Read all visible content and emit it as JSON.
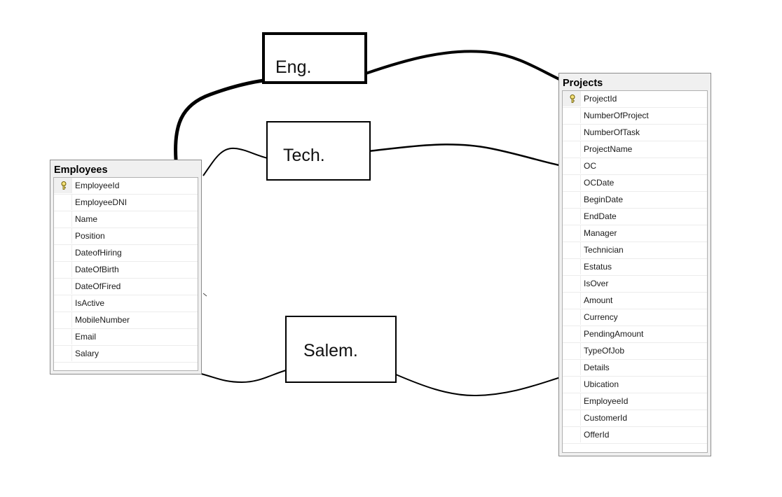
{
  "employees": {
    "title": "Employees",
    "columns": [
      {
        "name": "EmployeeId",
        "primary_key": true
      },
      {
        "name": "EmployeeDNI",
        "primary_key": false
      },
      {
        "name": "Name",
        "primary_key": false
      },
      {
        "name": "Position",
        "primary_key": false
      },
      {
        "name": "DateofHiring",
        "primary_key": false
      },
      {
        "name": "DateOfBirth",
        "primary_key": false
      },
      {
        "name": "DateOfFired",
        "primary_key": false
      },
      {
        "name": "IsActive",
        "primary_key": false
      },
      {
        "name": "MobileNumber",
        "primary_key": false
      },
      {
        "name": "Email",
        "primary_key": false
      },
      {
        "name": "Salary",
        "primary_key": false
      }
    ]
  },
  "projects": {
    "title": "Projects",
    "columns": [
      {
        "name": "ProjectId",
        "primary_key": true
      },
      {
        "name": "NumberOfProject",
        "primary_key": false
      },
      {
        "name": "NumberOfTask",
        "primary_key": false
      },
      {
        "name": "ProjectName",
        "primary_key": false
      },
      {
        "name": "OC",
        "primary_key": false
      },
      {
        "name": "OCDate",
        "primary_key": false
      },
      {
        "name": "BeginDate",
        "primary_key": false
      },
      {
        "name": "EndDate",
        "primary_key": false
      },
      {
        "name": "Manager",
        "primary_key": false
      },
      {
        "name": "Technician",
        "primary_key": false
      },
      {
        "name": "Estatus",
        "primary_key": false
      },
      {
        "name": "IsOver",
        "primary_key": false
      },
      {
        "name": "Amount",
        "primary_key": false
      },
      {
        "name": "Currency",
        "primary_key": false
      },
      {
        "name": "PendingAmount",
        "primary_key": false
      },
      {
        "name": "TypeOfJob",
        "primary_key": false
      },
      {
        "name": "Details",
        "primary_key": false
      },
      {
        "name": "Ubication",
        "primary_key": false
      },
      {
        "name": "EmployeeId",
        "primary_key": false
      },
      {
        "name": "CustomerId",
        "primary_key": false
      },
      {
        "name": "OfferId",
        "primary_key": false
      }
    ]
  },
  "relations": {
    "eng": "Eng.",
    "tech": "Tech.",
    "salem": "Salem."
  },
  "icons": {
    "primary_key": "key-icon"
  }
}
